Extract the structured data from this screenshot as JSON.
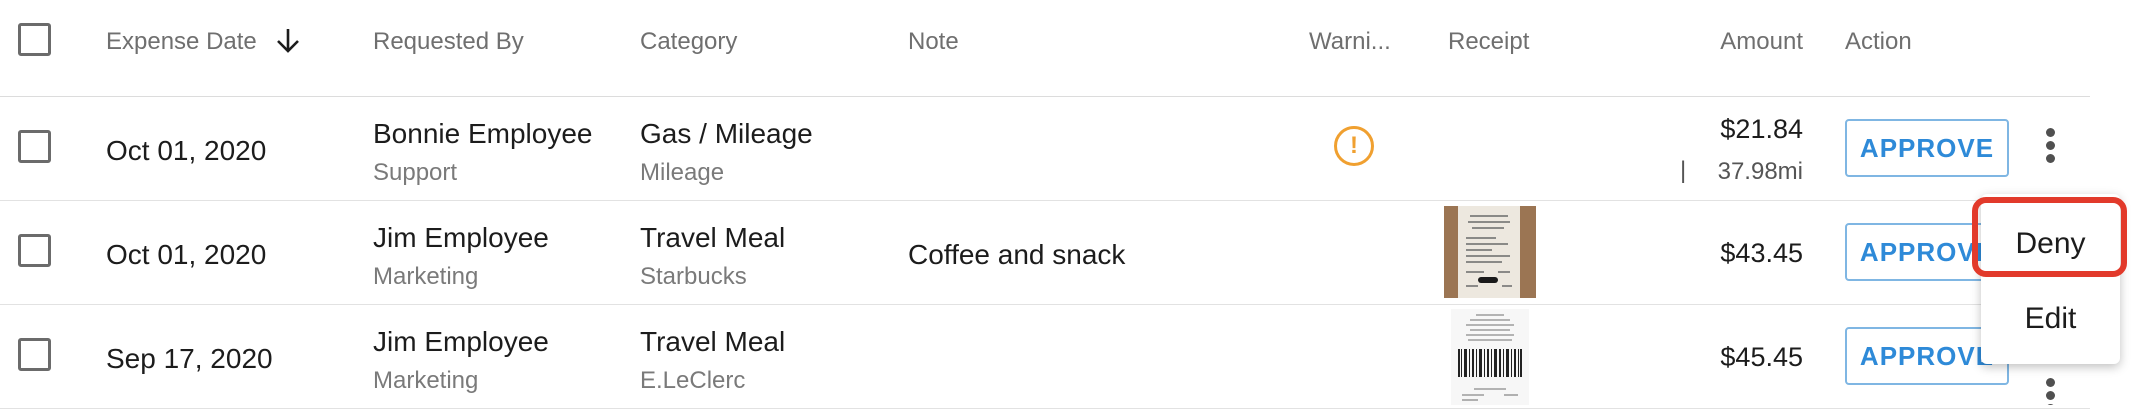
{
  "header": {
    "columns": [
      "Expense Date",
      "Requested By",
      "Category",
      "Note",
      "Warni...",
      "Receipt",
      "Amount",
      "Action"
    ]
  },
  "rows": [
    {
      "date": "Oct 01, 2020",
      "requested_by": "Bonnie Employee",
      "department": "Support",
      "category": "Gas / Mileage",
      "subcategory": "Mileage",
      "note": "",
      "amount": "$21.84",
      "amount_detail": "37.98mi",
      "amount_detail_prefix": "|",
      "action": "APPROVE"
    },
    {
      "date": "Oct 01, 2020",
      "requested_by": "Jim Employee",
      "department": "Marketing",
      "category": "Travel Meal",
      "subcategory": "Starbucks",
      "note": "Coffee and snack",
      "amount": "$43.45",
      "action": "APPROVE"
    },
    {
      "date": "Sep 17, 2020",
      "requested_by": "Jim Employee",
      "department": "Marketing",
      "category": "Travel Meal",
      "subcategory": "E.LeClerc",
      "note": "",
      "amount": "$45.45",
      "action": "APPROVE"
    }
  ],
  "warning_icon": "exclamation-circle-icon",
  "context_menu": {
    "items": [
      "Deny",
      "Edit"
    ],
    "highlighted": "Deny"
  },
  "colors": {
    "approve": "#2e8ad8",
    "warning": "#f0a030",
    "highlight": "#e23a2b"
  }
}
